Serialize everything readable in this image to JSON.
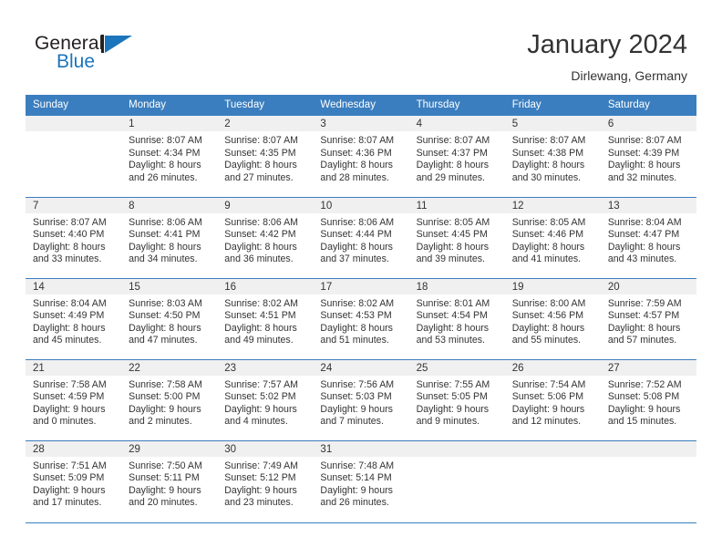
{
  "brand": {
    "name_part1": "General",
    "name_part2": "Blue",
    "accent_color": "#1b75bc"
  },
  "header": {
    "title": "January 2024",
    "subtitle": "Dirlewang, Germany"
  },
  "theme": {
    "header_row_color": "#3b7ebf",
    "daynum_band_color": "#f0f0f0",
    "text_color": "#333333"
  },
  "weekday_headers": [
    "Sunday",
    "Monday",
    "Tuesday",
    "Wednesday",
    "Thursday",
    "Friday",
    "Saturday"
  ],
  "weeks": [
    [
      {
        "day": "",
        "sunrise": "",
        "sunset": "",
        "daylight_line1": "",
        "daylight_line2": ""
      },
      {
        "day": "1",
        "sunrise": "Sunrise: 8:07 AM",
        "sunset": "Sunset: 4:34 PM",
        "daylight_line1": "Daylight: 8 hours",
        "daylight_line2": "and 26 minutes."
      },
      {
        "day": "2",
        "sunrise": "Sunrise: 8:07 AM",
        "sunset": "Sunset: 4:35 PM",
        "daylight_line1": "Daylight: 8 hours",
        "daylight_line2": "and 27 minutes."
      },
      {
        "day": "3",
        "sunrise": "Sunrise: 8:07 AM",
        "sunset": "Sunset: 4:36 PM",
        "daylight_line1": "Daylight: 8 hours",
        "daylight_line2": "and 28 minutes."
      },
      {
        "day": "4",
        "sunrise": "Sunrise: 8:07 AM",
        "sunset": "Sunset: 4:37 PM",
        "daylight_line1": "Daylight: 8 hours",
        "daylight_line2": "and 29 minutes."
      },
      {
        "day": "5",
        "sunrise": "Sunrise: 8:07 AM",
        "sunset": "Sunset: 4:38 PM",
        "daylight_line1": "Daylight: 8 hours",
        "daylight_line2": "and 30 minutes."
      },
      {
        "day": "6",
        "sunrise": "Sunrise: 8:07 AM",
        "sunset": "Sunset: 4:39 PM",
        "daylight_line1": "Daylight: 8 hours",
        "daylight_line2": "and 32 minutes."
      }
    ],
    [
      {
        "day": "7",
        "sunrise": "Sunrise: 8:07 AM",
        "sunset": "Sunset: 4:40 PM",
        "daylight_line1": "Daylight: 8 hours",
        "daylight_line2": "and 33 minutes."
      },
      {
        "day": "8",
        "sunrise": "Sunrise: 8:06 AM",
        "sunset": "Sunset: 4:41 PM",
        "daylight_line1": "Daylight: 8 hours",
        "daylight_line2": "and 34 minutes."
      },
      {
        "day": "9",
        "sunrise": "Sunrise: 8:06 AM",
        "sunset": "Sunset: 4:42 PM",
        "daylight_line1": "Daylight: 8 hours",
        "daylight_line2": "and 36 minutes."
      },
      {
        "day": "10",
        "sunrise": "Sunrise: 8:06 AM",
        "sunset": "Sunset: 4:44 PM",
        "daylight_line1": "Daylight: 8 hours",
        "daylight_line2": "and 37 minutes."
      },
      {
        "day": "11",
        "sunrise": "Sunrise: 8:05 AM",
        "sunset": "Sunset: 4:45 PM",
        "daylight_line1": "Daylight: 8 hours",
        "daylight_line2": "and 39 minutes."
      },
      {
        "day": "12",
        "sunrise": "Sunrise: 8:05 AM",
        "sunset": "Sunset: 4:46 PM",
        "daylight_line1": "Daylight: 8 hours",
        "daylight_line2": "and 41 minutes."
      },
      {
        "day": "13",
        "sunrise": "Sunrise: 8:04 AM",
        "sunset": "Sunset: 4:47 PM",
        "daylight_line1": "Daylight: 8 hours",
        "daylight_line2": "and 43 minutes."
      }
    ],
    [
      {
        "day": "14",
        "sunrise": "Sunrise: 8:04 AM",
        "sunset": "Sunset: 4:49 PM",
        "daylight_line1": "Daylight: 8 hours",
        "daylight_line2": "and 45 minutes."
      },
      {
        "day": "15",
        "sunrise": "Sunrise: 8:03 AM",
        "sunset": "Sunset: 4:50 PM",
        "daylight_line1": "Daylight: 8 hours",
        "daylight_line2": "and 47 minutes."
      },
      {
        "day": "16",
        "sunrise": "Sunrise: 8:02 AM",
        "sunset": "Sunset: 4:51 PM",
        "daylight_line1": "Daylight: 8 hours",
        "daylight_line2": "and 49 minutes."
      },
      {
        "day": "17",
        "sunrise": "Sunrise: 8:02 AM",
        "sunset": "Sunset: 4:53 PM",
        "daylight_line1": "Daylight: 8 hours",
        "daylight_line2": "and 51 minutes."
      },
      {
        "day": "18",
        "sunrise": "Sunrise: 8:01 AM",
        "sunset": "Sunset: 4:54 PM",
        "daylight_line1": "Daylight: 8 hours",
        "daylight_line2": "and 53 minutes."
      },
      {
        "day": "19",
        "sunrise": "Sunrise: 8:00 AM",
        "sunset": "Sunset: 4:56 PM",
        "daylight_line1": "Daylight: 8 hours",
        "daylight_line2": "and 55 minutes."
      },
      {
        "day": "20",
        "sunrise": "Sunrise: 7:59 AM",
        "sunset": "Sunset: 4:57 PM",
        "daylight_line1": "Daylight: 8 hours",
        "daylight_line2": "and 57 minutes."
      }
    ],
    [
      {
        "day": "21",
        "sunrise": "Sunrise: 7:58 AM",
        "sunset": "Sunset: 4:59 PM",
        "daylight_line1": "Daylight: 9 hours",
        "daylight_line2": "and 0 minutes."
      },
      {
        "day": "22",
        "sunrise": "Sunrise: 7:58 AM",
        "sunset": "Sunset: 5:00 PM",
        "daylight_line1": "Daylight: 9 hours",
        "daylight_line2": "and 2 minutes."
      },
      {
        "day": "23",
        "sunrise": "Sunrise: 7:57 AM",
        "sunset": "Sunset: 5:02 PM",
        "daylight_line1": "Daylight: 9 hours",
        "daylight_line2": "and 4 minutes."
      },
      {
        "day": "24",
        "sunrise": "Sunrise: 7:56 AM",
        "sunset": "Sunset: 5:03 PM",
        "daylight_line1": "Daylight: 9 hours",
        "daylight_line2": "and 7 minutes."
      },
      {
        "day": "25",
        "sunrise": "Sunrise: 7:55 AM",
        "sunset": "Sunset: 5:05 PM",
        "daylight_line1": "Daylight: 9 hours",
        "daylight_line2": "and 9 minutes."
      },
      {
        "day": "26",
        "sunrise": "Sunrise: 7:54 AM",
        "sunset": "Sunset: 5:06 PM",
        "daylight_line1": "Daylight: 9 hours",
        "daylight_line2": "and 12 minutes."
      },
      {
        "day": "27",
        "sunrise": "Sunrise: 7:52 AM",
        "sunset": "Sunset: 5:08 PM",
        "daylight_line1": "Daylight: 9 hours",
        "daylight_line2": "and 15 minutes."
      }
    ],
    [
      {
        "day": "28",
        "sunrise": "Sunrise: 7:51 AM",
        "sunset": "Sunset: 5:09 PM",
        "daylight_line1": "Daylight: 9 hours",
        "daylight_line2": "and 17 minutes."
      },
      {
        "day": "29",
        "sunrise": "Sunrise: 7:50 AM",
        "sunset": "Sunset: 5:11 PM",
        "daylight_line1": "Daylight: 9 hours",
        "daylight_line2": "and 20 minutes."
      },
      {
        "day": "30",
        "sunrise": "Sunrise: 7:49 AM",
        "sunset": "Sunset: 5:12 PM",
        "daylight_line1": "Daylight: 9 hours",
        "daylight_line2": "and 23 minutes."
      },
      {
        "day": "31",
        "sunrise": "Sunrise: 7:48 AM",
        "sunset": "Sunset: 5:14 PM",
        "daylight_line1": "Daylight: 9 hours",
        "daylight_line2": "and 26 minutes."
      },
      {
        "day": "",
        "sunrise": "",
        "sunset": "",
        "daylight_line1": "",
        "daylight_line2": ""
      },
      {
        "day": "",
        "sunrise": "",
        "sunset": "",
        "daylight_line1": "",
        "daylight_line2": ""
      },
      {
        "day": "",
        "sunrise": "",
        "sunset": "",
        "daylight_line1": "",
        "daylight_line2": ""
      }
    ]
  ]
}
